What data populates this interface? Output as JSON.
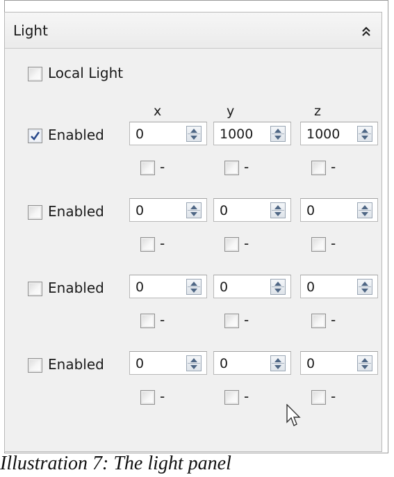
{
  "panel": {
    "title": "Light",
    "collapse_icon": "double-chevron-up-icon"
  },
  "local_light": {
    "label": "Local Light",
    "checked": false
  },
  "axes": [
    "x",
    "y",
    "z"
  ],
  "lights": [
    {
      "enabled_label": "Enabled",
      "enabled": true,
      "values": [
        "0",
        "1000",
        "1000"
      ],
      "negate_label": "-",
      "negate_checked": [
        false,
        false,
        false
      ]
    },
    {
      "enabled_label": "Enabled",
      "enabled": false,
      "values": [
        "0",
        "0",
        "0"
      ],
      "negate_label": "-",
      "negate_checked": [
        false,
        false,
        false
      ]
    },
    {
      "enabled_label": "Enabled",
      "enabled": false,
      "values": [
        "0",
        "0",
        "0"
      ],
      "negate_label": "-",
      "negate_checked": [
        false,
        false,
        false
      ]
    },
    {
      "enabled_label": "Enabled",
      "enabled": false,
      "values": [
        "0",
        "0",
        "0"
      ],
      "negate_label": "-",
      "negate_checked": [
        false,
        false,
        false
      ]
    }
  ],
  "caption": "Illustration 7: The light panel",
  "colors": {
    "checkmark": "#2a4a8c",
    "panel_bg": "#f0f0f0",
    "spin_arrow": "#4f6785"
  }
}
